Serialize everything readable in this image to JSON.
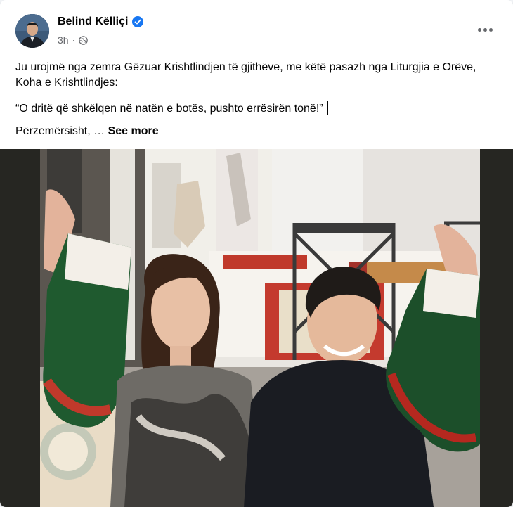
{
  "post": {
    "author": "Belind Këlliçi",
    "time": "3h",
    "paragraph1": "Ju urojmë nga zemra Gëzuar Krishtlindjen të gjithëve, me këtë pasazh nga Liturgjia e Orëve, Koha e Krishtlindjes:",
    "quote": "“O dritë që shkëlqen në natën e botës, pushto errësirën tonë!”",
    "paragraph3": "Përzemërsisht, …",
    "see_more": "See more"
  },
  "icons": {
    "verified": "verified-badge-icon",
    "audience": "globe-icon",
    "menu": "more-options-icon"
  },
  "colors": {
    "accent": "#1877f2",
    "text": "#050505",
    "secondary": "#65676b"
  }
}
